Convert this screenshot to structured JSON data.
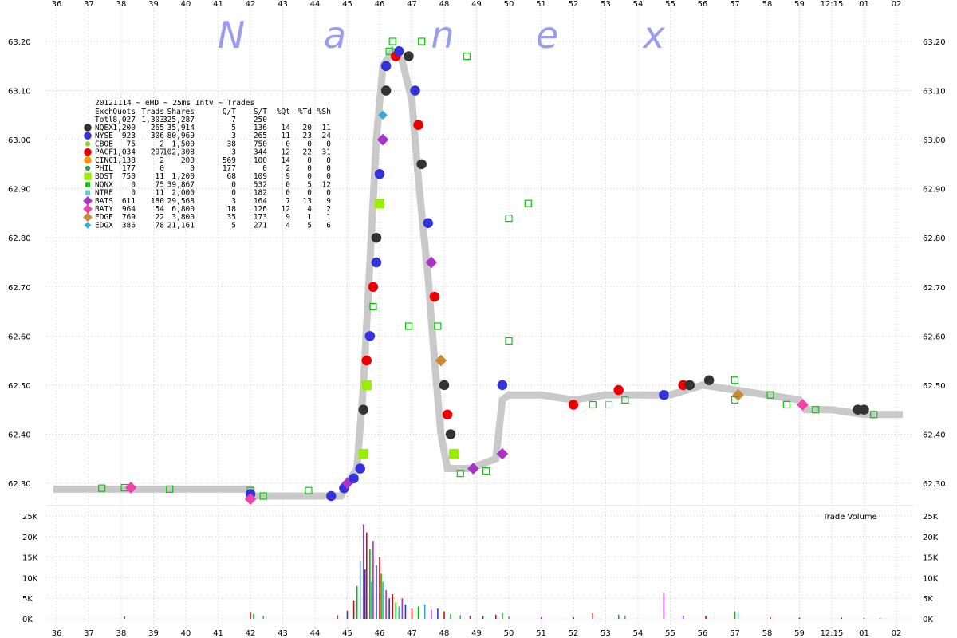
{
  "logo_letters": [
    "N",
    "a",
    "n",
    "e",
    "x"
  ],
  "chart_data": {
    "type": "scatter",
    "title": "20121114 ~ eHD ~ 25ms Intv ~ Trades",
    "x_ticks": [
      "36",
      "37",
      "38",
      "39",
      "40",
      "41",
      "42",
      "43",
      "44",
      "45",
      "46",
      "47",
      "48",
      "49",
      "50",
      "51",
      "52",
      "53",
      "54",
      "55",
      "56",
      "57",
      "58",
      "59",
      "12:15",
      "01",
      "02"
    ],
    "y_ticks": [
      "63.20",
      "63.10",
      "63.00",
      "62.90",
      "62.80",
      "62.70",
      "62.60",
      "62.50",
      "62.40",
      "62.30"
    ],
    "ylim": [
      62.26,
      63.22
    ],
    "volume_ticks": [
      "25K",
      "20K",
      "15K",
      "10K",
      "5K",
      "0K"
    ],
    "volume_label": "Trade Volume",
    "grid": true,
    "legend_header": [
      "Exch",
      "Quots",
      "Trads",
      "Shares",
      "Q/T",
      "S/T",
      "%Qt",
      "%Td",
      "%Sh"
    ],
    "legend_total": [
      "Totl",
      "8,027",
      "1,303",
      "325,287",
      "7",
      "250",
      "",
      "",
      ""
    ],
    "legend_rows": [
      {
        "exch": "NQEX",
        "quots": "1,200",
        "trads": "265",
        "shares": "35,914",
        "qt": "5",
        "st": "136",
        "pqt": "14",
        "ptd": "20",
        "psh": "11",
        "color": "#333333",
        "shape": "circle"
      },
      {
        "exch": "NYSE",
        "quots": "923",
        "trads": "306",
        "shares": "80,969",
        "qt": "3",
        "st": "265",
        "pqt": "11",
        "ptd": "23",
        "psh": "24",
        "color": "#3333dd",
        "shape": "circle"
      },
      {
        "exch": "CBOE",
        "quots": "75",
        "trads": "2",
        "shares": "1,500",
        "qt": "38",
        "st": "750",
        "pqt": "0",
        "ptd": "0",
        "psh": "0",
        "color": "#99cc33",
        "shape": "circle-small"
      },
      {
        "exch": "PACF",
        "quots": "1,034",
        "trads": "297",
        "shares": "102,308",
        "qt": "3",
        "st": "344",
        "pqt": "12",
        "ptd": "22",
        "psh": "31",
        "color": "#ee0000",
        "shape": "circle"
      },
      {
        "exch": "CINC",
        "quots": "1,138",
        "trads": "2",
        "shares": "200",
        "qt": "569",
        "st": "100",
        "pqt": "14",
        "ptd": "0",
        "psh": "0",
        "color": "#ff9900",
        "shape": "circle"
      },
      {
        "exch": "PHIL",
        "quots": "177",
        "trads": "0",
        "shares": "0",
        "qt": "177",
        "st": "0",
        "pqt": "2",
        "ptd": "0",
        "psh": "0",
        "color": "#339966",
        "shape": "circle-small"
      },
      {
        "exch": "BOST",
        "quots": "750",
        "trads": "11",
        "shares": "1,200",
        "qt": "68",
        "st": "109",
        "pqt": "9",
        "ptd": "0",
        "psh": "0",
        "color": "#99ee00",
        "shape": "square"
      },
      {
        "exch": "NQNX",
        "quots": "0",
        "trads": "75",
        "shares": "39,867",
        "qt": "0",
        "st": "532",
        "pqt": "0",
        "ptd": "5",
        "psh": "12",
        "color": "#00cc00",
        "shape": "square-small"
      },
      {
        "exch": "NTRF",
        "quots": "0",
        "trads": "11",
        "shares": "2,000",
        "qt": "0",
        "st": "182",
        "pqt": "0",
        "ptd": "0",
        "psh": "0",
        "color": "#66cccc",
        "shape": "square-small"
      },
      {
        "exch": "BATS",
        "quots": "611",
        "trads": "180",
        "shares": "29,568",
        "qt": "3",
        "st": "164",
        "pqt": "7",
        "ptd": "13",
        "psh": "9",
        "color": "#aa33cc",
        "shape": "diamond"
      },
      {
        "exch": "BATY",
        "quots": "964",
        "trads": "54",
        "shares": "6,800",
        "qt": "18",
        "st": "126",
        "pqt": "12",
        "ptd": "4",
        "psh": "2",
        "color": "#ee44aa",
        "shape": "diamond"
      },
      {
        "exch": "EDGE",
        "quots": "769",
        "trads": "22",
        "shares": "3,800",
        "qt": "35",
        "st": "173",
        "pqt": "9",
        "ptd": "1",
        "psh": "1",
        "color": "#cc8833",
        "shape": "diamond"
      },
      {
        "exch": "EDGX",
        "quots": "386",
        "trads": "78",
        "shares": "21,161",
        "qt": "5",
        "st": "271",
        "pqt": "4",
        "ptd": "5",
        "psh": "6",
        "color": "#33aadd",
        "shape": "diamond-small"
      }
    ],
    "quote_path": [
      [
        35.9,
        62.288
      ],
      [
        42.0,
        62.288
      ],
      [
        42.0,
        62.274
      ],
      [
        44.8,
        62.274
      ],
      [
        45.0,
        62.3
      ],
      [
        45.3,
        62.33
      ],
      [
        45.5,
        62.5
      ],
      [
        45.7,
        62.75
      ],
      [
        45.9,
        63.0
      ],
      [
        46.1,
        63.15
      ],
      [
        46.4,
        63.18
      ],
      [
        46.7,
        63.16
      ],
      [
        47.0,
        63.08
      ],
      [
        47.2,
        62.92
      ],
      [
        47.5,
        62.72
      ],
      [
        47.7,
        62.55
      ],
      [
        47.9,
        62.4
      ],
      [
        48.1,
        62.33
      ],
      [
        48.4,
        62.33
      ],
      [
        48.8,
        62.33
      ],
      [
        49.2,
        62.34
      ],
      [
        49.6,
        62.35
      ],
      [
        49.8,
        62.47
      ],
      [
        50.0,
        62.48
      ],
      [
        51.0,
        62.48
      ],
      [
        52.0,
        62.47
      ],
      [
        53.0,
        62.48
      ],
      [
        54.0,
        62.48
      ],
      [
        55.0,
        62.48
      ],
      [
        56.0,
        62.5
      ],
      [
        57.0,
        62.49
      ],
      [
        58.0,
        62.48
      ],
      [
        59.0,
        62.47
      ],
      [
        59.2,
        62.45
      ],
      [
        60.0,
        62.45
      ],
      [
        61.0,
        62.44
      ],
      [
        62.2,
        62.44
      ]
    ],
    "trades": [
      [
        37.4,
        62.29,
        "NQNX"
      ],
      [
        38.1,
        62.291,
        "NQNX"
      ],
      [
        38.3,
        62.291,
        "BATY"
      ],
      [
        39.5,
        62.288,
        "NQNX"
      ],
      [
        42.0,
        62.285,
        "NQNX"
      ],
      [
        42.0,
        62.278,
        "NYSE"
      ],
      [
        42.0,
        62.268,
        "BATY"
      ],
      [
        42.4,
        62.274,
        "NQNX"
      ],
      [
        43.8,
        62.285,
        "NQNX"
      ],
      [
        44.5,
        62.274,
        "NYSE"
      ],
      [
        44.9,
        62.29,
        "NYSE"
      ],
      [
        45.0,
        62.3,
        "BATS"
      ],
      [
        45.2,
        62.31,
        "NYSE"
      ],
      [
        45.4,
        62.33,
        "NYSE"
      ],
      [
        45.5,
        62.36,
        "BOST"
      ],
      [
        45.5,
        62.45,
        "NQEX"
      ],
      [
        45.6,
        62.5,
        "BOST"
      ],
      [
        45.6,
        62.55,
        "PACF"
      ],
      [
        45.7,
        62.6,
        "NYSE"
      ],
      [
        45.8,
        62.66,
        "NQNX"
      ],
      [
        45.8,
        62.7,
        "PACF"
      ],
      [
        45.9,
        62.75,
        "NYSE"
      ],
      [
        45.9,
        62.8,
        "NQEX"
      ],
      [
        46.0,
        62.87,
        "BOST"
      ],
      [
        46.0,
        62.93,
        "NYSE"
      ],
      [
        46.1,
        63.0,
        "BATS"
      ],
      [
        46.1,
        63.05,
        "EDGX"
      ],
      [
        46.2,
        63.1,
        "NQEX"
      ],
      [
        46.2,
        63.15,
        "NYSE"
      ],
      [
        46.3,
        63.18,
        "NQNX"
      ],
      [
        46.4,
        63.2,
        "NQNX"
      ],
      [
        46.5,
        63.17,
        "PACF"
      ],
      [
        46.6,
        63.18,
        "NYSE"
      ],
      [
        46.9,
        63.17,
        "NQEX"
      ],
      [
        47.1,
        63.1,
        "NYSE"
      ],
      [
        47.2,
        63.03,
        "PACF"
      ],
      [
        47.3,
        62.95,
        "NQEX"
      ],
      [
        47.5,
        62.83,
        "NYSE"
      ],
      [
        47.6,
        62.75,
        "BATS"
      ],
      [
        47.7,
        62.68,
        "PACF"
      ],
      [
        47.8,
        62.62,
        "NQNX"
      ],
      [
        47.9,
        62.55,
        "EDGE"
      ],
      [
        48.0,
        62.5,
        "NQEX"
      ],
      [
        48.1,
        62.44,
        "PACF"
      ],
      [
        48.2,
        62.4,
        "NQEX"
      ],
      [
        48.3,
        62.36,
        "BOST"
      ],
      [
        48.5,
        62.32,
        "NQNX"
      ],
      [
        48.9,
        62.33,
        "BATS"
      ],
      [
        49.3,
        62.325,
        "NQNX"
      ],
      [
        49.8,
        62.36,
        "BATS"
      ],
      [
        49.8,
        62.5,
        "NYSE"
      ],
      [
        50.0,
        62.59,
        "NQNX"
      ],
      [
        50.0,
        62.84,
        "NQNX"
      ],
      [
        50.6,
        62.87,
        "NQNX"
      ],
      [
        48.7,
        63.17,
        "NQNX"
      ],
      [
        47.3,
        63.2,
        "NQNX"
      ],
      [
        46.9,
        62.62,
        "NQNX"
      ],
      [
        52.0,
        62.46,
        "PACF"
      ],
      [
        52.6,
        62.46,
        "NQNX"
      ],
      [
        53.1,
        62.46,
        "NTRF"
      ],
      [
        53.4,
        62.49,
        "PACF"
      ],
      [
        53.6,
        62.47,
        "NQNX"
      ],
      [
        54.8,
        62.48,
        "NYSE"
      ],
      [
        55.4,
        62.5,
        "PACF"
      ],
      [
        55.6,
        62.5,
        "NQEX"
      ],
      [
        56.2,
        62.51,
        "NQEX"
      ],
      [
        57.0,
        62.51,
        "NQNX"
      ],
      [
        57.1,
        62.48,
        "EDGE"
      ],
      [
        57.0,
        62.47,
        "NQNX"
      ],
      [
        58.1,
        62.48,
        "NQNX"
      ],
      [
        58.6,
        62.46,
        "NQNX"
      ],
      [
        59.1,
        62.46,
        "BATY"
      ],
      [
        59.5,
        62.45,
        "NQNX"
      ],
      [
        60.8,
        62.45,
        "NQEX"
      ],
      [
        61.0,
        62.45,
        "NQEX"
      ],
      [
        61.3,
        62.44,
        "NQNX"
      ]
    ],
    "volume_bars": [
      [
        38.1,
        600
      ],
      [
        42.0,
        1500
      ],
      [
        42.1,
        1200
      ],
      [
        42.4,
        700
      ],
      [
        44.7,
        900
      ],
      [
        45.0,
        2000
      ],
      [
        45.2,
        4500
      ],
      [
        45.3,
        8000
      ],
      [
        45.4,
        14000
      ],
      [
        45.5,
        23000
      ],
      [
        45.55,
        12000
      ],
      [
        45.6,
        21000
      ],
      [
        45.7,
        17000
      ],
      [
        45.75,
        9000
      ],
      [
        45.8,
        19000
      ],
      [
        45.9,
        13000
      ],
      [
        46.0,
        15000
      ],
      [
        46.05,
        11000
      ],
      [
        46.1,
        9000
      ],
      [
        46.2,
        7000
      ],
      [
        46.3,
        5000
      ],
      [
        46.4,
        6000
      ],
      [
        46.5,
        4000
      ],
      [
        46.6,
        3000
      ],
      [
        46.7,
        5000
      ],
      [
        46.8,
        3500
      ],
      [
        47.0,
        2500
      ],
      [
        47.2,
        3000
      ],
      [
        47.4,
        3500
      ],
      [
        47.6,
        2200
      ],
      [
        47.8,
        2500
      ],
      [
        48.0,
        1800
      ],
      [
        48.2,
        1200
      ],
      [
        48.5,
        900
      ],
      [
        48.8,
        800
      ],
      [
        49.2,
        700
      ],
      [
        49.6,
        1000
      ],
      [
        49.8,
        1400
      ],
      [
        50.0,
        600
      ],
      [
        51.0,
        400
      ],
      [
        52.0,
        400
      ],
      [
        52.6,
        1400
      ],
      [
        53.4,
        1000
      ],
      [
        53.6,
        800
      ],
      [
        54.8,
        6400
      ],
      [
        55.4,
        800
      ],
      [
        56.1,
        700
      ],
      [
        57.0,
        1800
      ],
      [
        57.1,
        1500
      ],
      [
        58.1,
        400
      ],
      [
        59.0,
        300
      ],
      [
        60.3,
        300
      ],
      [
        61.0,
        200
      ],
      [
        61.5,
        200
      ]
    ]
  }
}
